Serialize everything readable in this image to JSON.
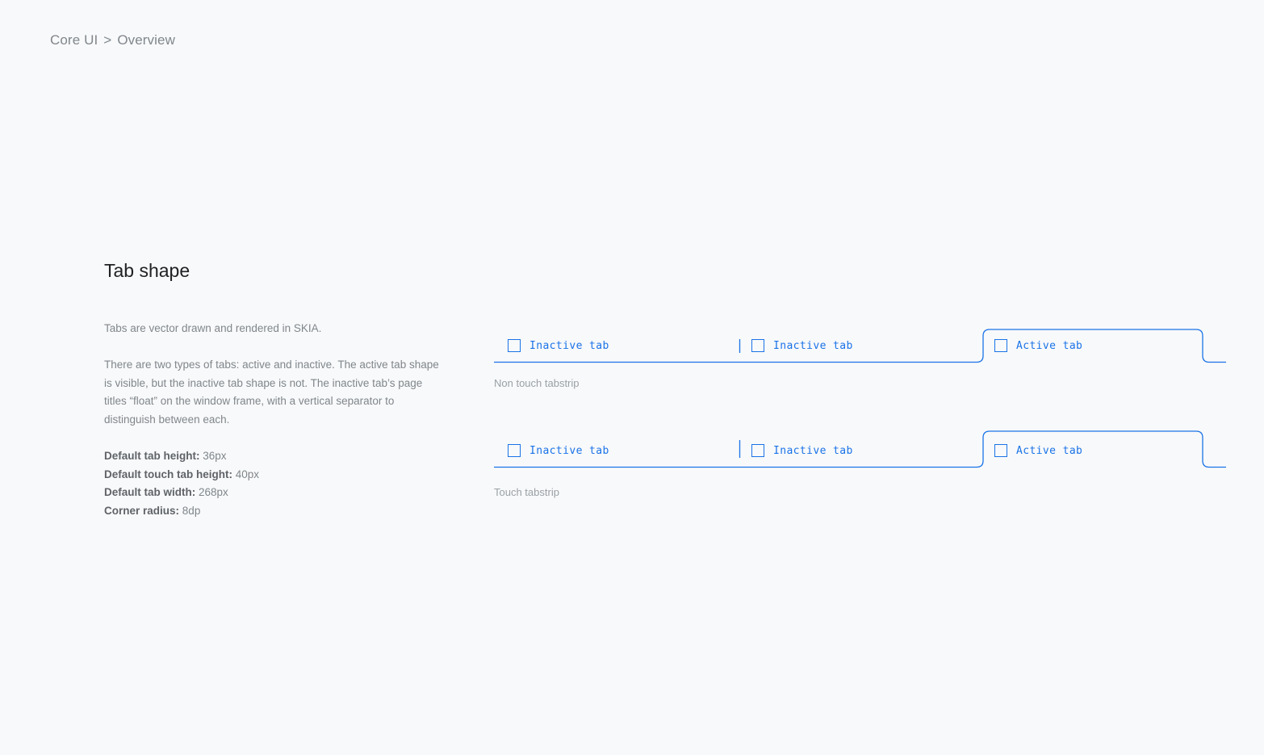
{
  "breadcrumb": {
    "root": "Core UI",
    "separator": ">",
    "current": "Overview"
  },
  "section": {
    "title": "Tab shape",
    "paragraphs": [
      "Tabs are vector drawn and rendered in SKIA.",
      "There are two types of tabs: active and inactive. The active tab shape is visible, but the inactive tab shape is not. The inactive tab’s page titles “float” on the window frame, with a vertical separator to distinguish between each."
    ],
    "specs": [
      {
        "label": "Default tab height:",
        "value": "36px"
      },
      {
        "label": "Default touch tab height:",
        "value": "40px"
      },
      {
        "label": "Default tab width:",
        "value": "268px"
      },
      {
        "label": "Corner radius:",
        "value": "8dp"
      }
    ]
  },
  "strips": [
    {
      "caption": "Non touch tabstrip",
      "tabs": [
        {
          "label": "Inactive tab",
          "state": "inactive",
          "icon": "favicon-square-icon"
        },
        {
          "label": "Inactive tab",
          "state": "inactive",
          "icon": "favicon-square-icon"
        },
        {
          "label": "Active tab",
          "state": "active",
          "icon": "favicon-square-icon"
        }
      ]
    },
    {
      "caption": "Touch tabstrip",
      "tabs": [
        {
          "label": "Inactive tab",
          "state": "inactive",
          "icon": "favicon-square-icon"
        },
        {
          "label": "Inactive tab",
          "state": "inactive",
          "icon": "favicon-square-icon"
        },
        {
          "label": "Active tab",
          "state": "active",
          "icon": "favicon-square-icon"
        }
      ]
    }
  ],
  "colors": {
    "accent": "#1a73e8",
    "background": "#f8f9fa",
    "title": "#202124",
    "body_text": "#80868b",
    "caption": "#9aa0a6"
  }
}
